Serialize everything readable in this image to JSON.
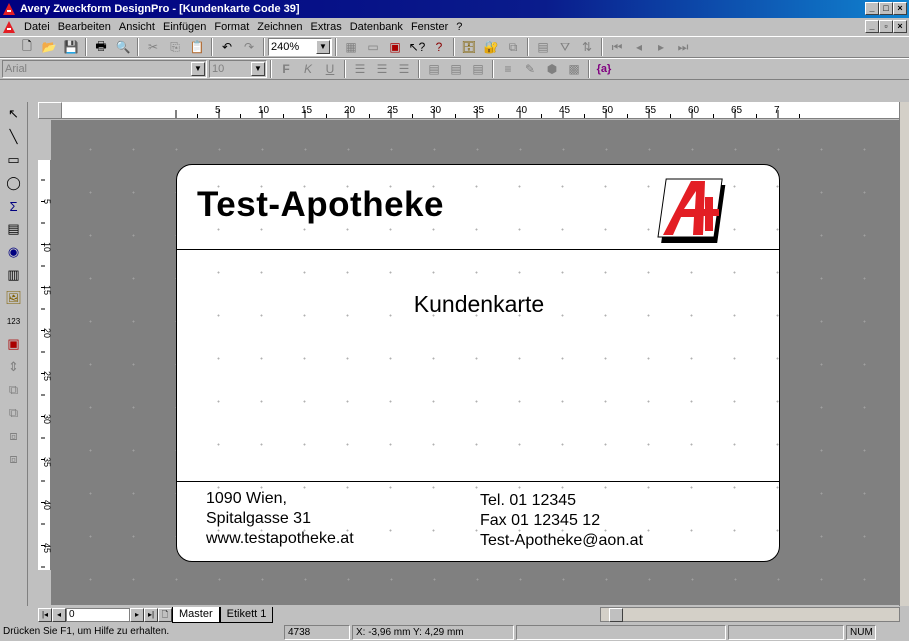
{
  "window": {
    "title": "Avery Zweckform DesignPro - [Kundenkarte Code 39]"
  },
  "menubar": {
    "items": [
      "Datei",
      "Bearbeiten",
      "Ansicht",
      "Einfügen",
      "Format",
      "Zeichnen",
      "Extras",
      "Datenbank",
      "Fenster",
      "?"
    ]
  },
  "toolbar": {
    "zoom": "240%"
  },
  "formatbar": {
    "font": "Arial",
    "size": "10",
    "bold": "F",
    "italic": "K",
    "underline": "U",
    "field_icon": "{a}"
  },
  "ruler": {
    "h_labels": [
      "5",
      "10",
      "15",
      "20",
      "25",
      "30",
      "35",
      "40",
      "45",
      "50",
      "55",
      "60",
      "65",
      "7"
    ],
    "v_labels": [
      "5",
      "10",
      "15",
      "20",
      "25",
      "30",
      "35",
      "40",
      "45",
      "50"
    ]
  },
  "card": {
    "title": "Test-Apotheke",
    "heading": "Kundenkarte",
    "address_left": [
      "1090 Wien,",
      "Spitalgasse 31",
      "www.testapotheke.at"
    ],
    "address_right": [
      "Tel. 01 12345",
      "Fax 01 12345 12",
      "Test-Apotheke@aon.at"
    ]
  },
  "tabs": {
    "page": "0",
    "master": "Master",
    "label1": "Etikett 1"
  },
  "status": {
    "help": "Drücken Sie F1, um Hilfe zu erhalten.",
    "count": "4738",
    "coords": "X: -3,96 mm  Y: 4,29 mm",
    "num": "NUM"
  },
  "colors": {
    "title_bg": "#000080",
    "accent_red": "#e31e24"
  }
}
